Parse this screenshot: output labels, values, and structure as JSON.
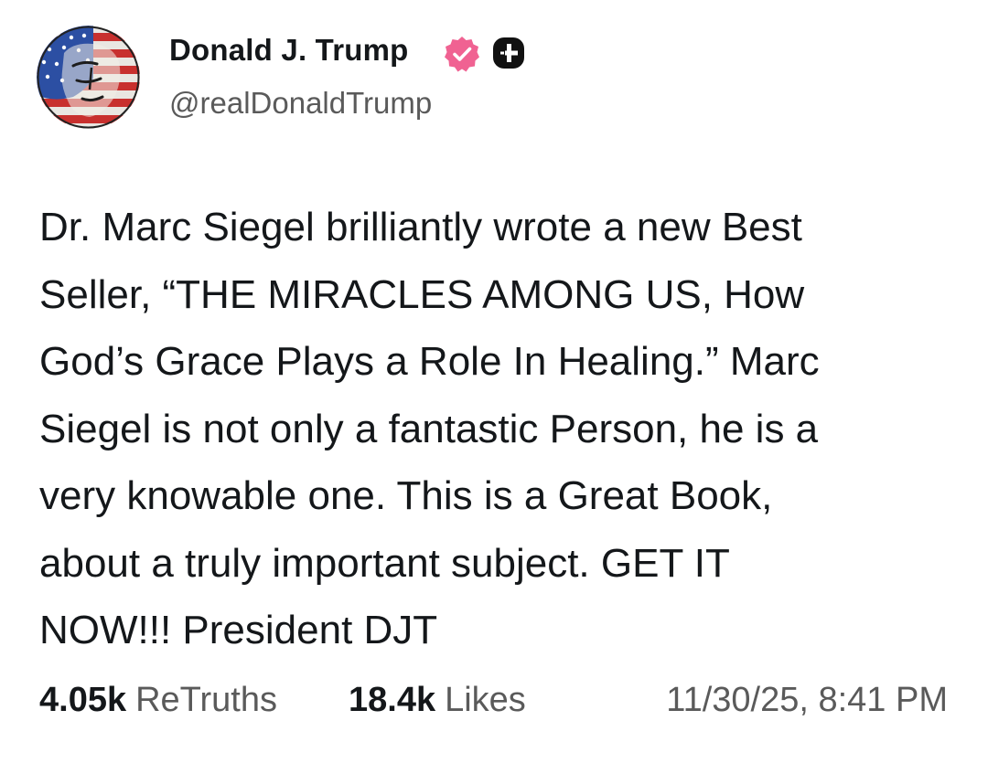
{
  "author": {
    "display_name": "Donald J. Trump",
    "handle": "@realDonaldTrump",
    "verified": true,
    "avatar_icon": "avatar-flag-portrait-icon",
    "badges": [
      "verified-badge-icon",
      "plus-badge-icon"
    ]
  },
  "post": {
    "text": "Dr. Marc Siegel brilliantly wrote a new Best\nSeller, “THE MIRACLES AMONG US, How\nGod’s Grace Plays a Role In Healing.” Marc\nSiegel is not only a fantastic Person, he is a\nvery knowable one. This is a Great Book,\nabout a truly important subject. GET IT\nNOW!!! President DJT"
  },
  "stats": {
    "retruths_count": "4.05k",
    "retruths_label": "ReTruths",
    "likes_count": "18.4k",
    "likes_label": "Likes",
    "timestamp": "11/30/25, 8:41 PM"
  },
  "colors": {
    "text_primary": "#14171a",
    "text_secondary": "#5a5a5a",
    "verified_badge": "#f06292",
    "background": "#ffffff"
  }
}
